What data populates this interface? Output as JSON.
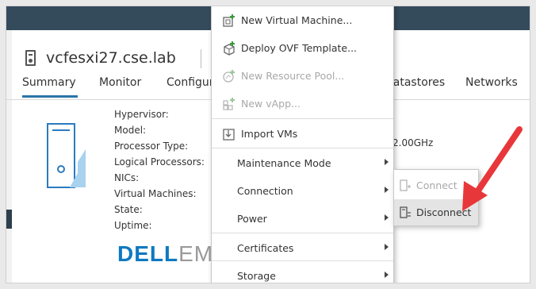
{
  "host": {
    "name": "vcfesxi27.cse.lab",
    "icon": "server-host-icon"
  },
  "tabs": [
    "Summary",
    "Monitor",
    "Configure",
    "Datastores",
    "Networks"
  ],
  "active_tab": "Summary",
  "properties": {
    "labels": [
      "Hypervisor:",
      "Model:",
      "Processor Type:",
      "Logical Processors:",
      "NICs:",
      "Virtual Machines:",
      "State:",
      "Uptime:"
    ],
    "processor_speed_fragment": "2.00GHz"
  },
  "logo": {
    "dell": "DELL",
    "em": "EM"
  },
  "context_menu": {
    "new_vm": "New Virtual Machine...",
    "deploy_ovf": "Deploy OVF Template...",
    "new_pool": "New Resource Pool...",
    "new_vapp": "New vApp...",
    "import_vms": "Import VMs",
    "maintenance": "Maintenance Mode",
    "connection": "Connection",
    "power": "Power",
    "certificates": "Certificates",
    "storage": "Storage"
  },
  "connection_submenu": {
    "connect": "Connect",
    "disconnect": "Disconnect"
  },
  "colors": {
    "accent_tab": "#2a75a8",
    "topbar": "#344b5c",
    "annotation_arrow": "#e8373a",
    "dell_blue": "#0e79c1"
  }
}
